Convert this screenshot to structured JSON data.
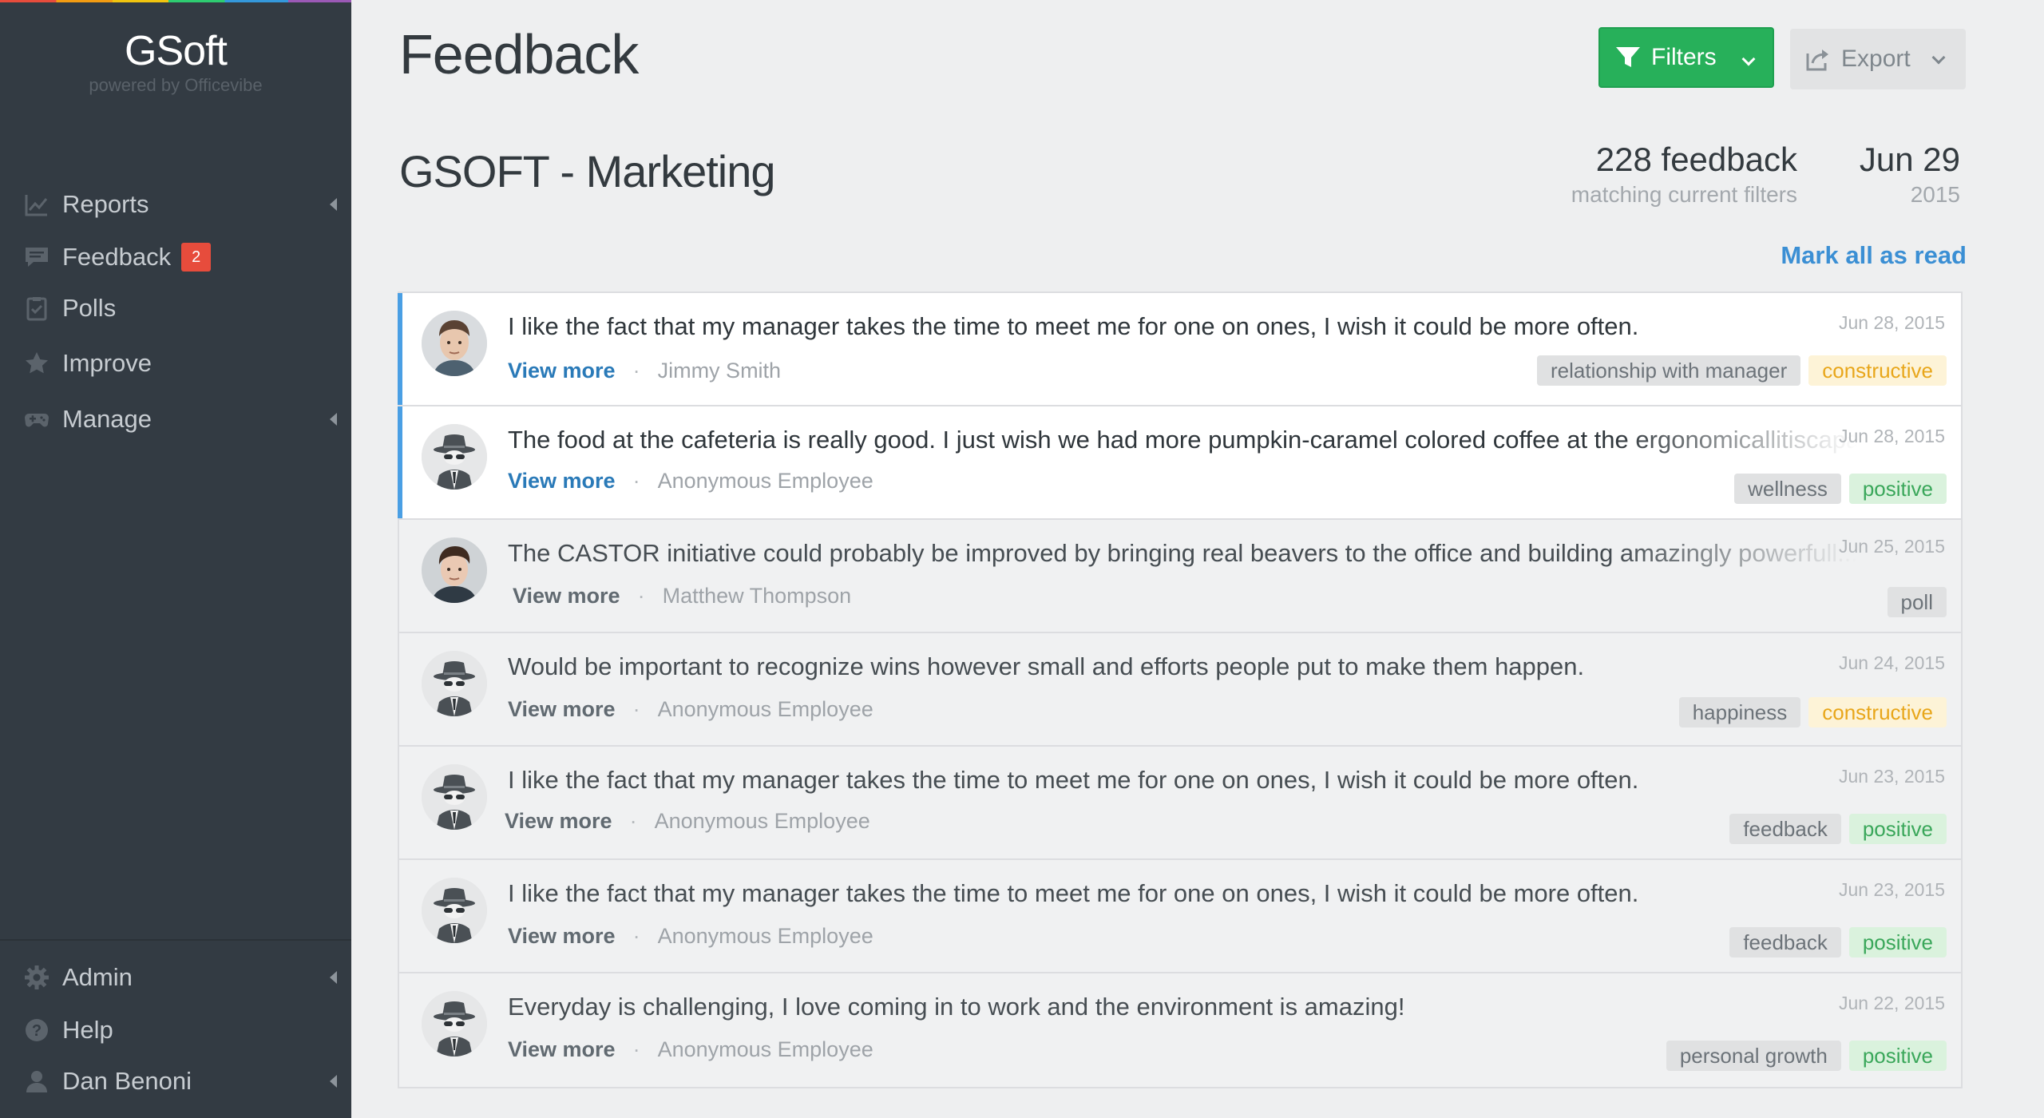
{
  "brand": {
    "name": "GSoft",
    "sub": "powered by Officevibe"
  },
  "sidebar": {
    "items": [
      {
        "label": "Reports",
        "icon": "chart-line-icon",
        "has_caret": true
      },
      {
        "label": "Feedback",
        "icon": "comment-icon",
        "badge": "2"
      },
      {
        "label": "Polls",
        "icon": "clipboard-check-icon"
      },
      {
        "label": "Improve",
        "icon": "star-icon"
      },
      {
        "label": "Manage",
        "icon": "gamepad-icon",
        "has_caret": true
      }
    ],
    "bottom": [
      {
        "label": "Admin",
        "icon": "gear-icon"
      },
      {
        "label": "Help",
        "icon": "question-circle-icon"
      },
      {
        "label": "Dan Benoni",
        "icon": "user-icon"
      }
    ]
  },
  "header": {
    "title": "Feedback",
    "filters_label": "Filters",
    "export_label": "Export"
  },
  "summary": {
    "team": "GSOFT - Marketing",
    "count": "228 feedback",
    "count_label": "matching current filters",
    "date_day": "Jun 29",
    "date_year": "2015",
    "mark_all": "Mark all as read"
  },
  "feed": [
    {
      "text": "I like the fact that my manager takes the time to meet me for one on ones, I wish it could be more often.",
      "view_more": "View more",
      "author": "Jimmy Smith",
      "date": "Jun 28, 2015",
      "tags": [
        "relationship with manager",
        "constructive"
      ]
    },
    {
      "text": "The food at the cafeteria is really good. I just wish we had more pumpkin-caramel colored coffee at the ergonomicallitiscapable",
      "view_more": "View more",
      "author": "Anonymous Employee",
      "date": "Jun 28, 2015",
      "tags": [
        "wellness",
        "positive"
      ]
    },
    {
      "text": "The CASTOR initiative could probably be improved by bringing real beavers to the office and building amazingly powerfull...",
      "view_more": "View more",
      "author": "Matthew Thompson",
      "date": "Jun 25, 2015",
      "tags": [
        "poll"
      ]
    },
    {
      "text": "Would be important to recognize wins however small and efforts people put to make them happen.",
      "view_more": "View more",
      "author": "Anonymous Employee",
      "date": "Jun 24, 2015",
      "tags": [
        "happiness",
        "constructive"
      ]
    },
    {
      "text": "I like the fact that my manager takes the time to meet me for one on ones, I wish it could be more often.",
      "view_more": "View more",
      "author": "Anonymous Employee",
      "date": "Jun 23, 2015",
      "tags": [
        "feedback",
        "positive"
      ]
    },
    {
      "text": "I like the fact that my manager takes the time to meet me for one on ones, I wish it could be more often.",
      "view_more": "View more",
      "author": "Anonymous Employee",
      "date": "Jun 23, 2015",
      "tags": [
        "feedback",
        "positive"
      ]
    },
    {
      "text": "Everyday is challenging, I love coming in to work and the environment is amazing!",
      "view_more": "View more",
      "author": "Anonymous Employee",
      "date": "Jun 22, 2015",
      "tags": [
        "personal growth",
        "positive"
      ]
    }
  ],
  "colors": {
    "accent_green": "#27b05a",
    "link_blue": "#3b8fd4",
    "unread_bar": "#4a9fe4",
    "sidebar_bg": "#333b43",
    "badge_red": "#e74c3c"
  }
}
